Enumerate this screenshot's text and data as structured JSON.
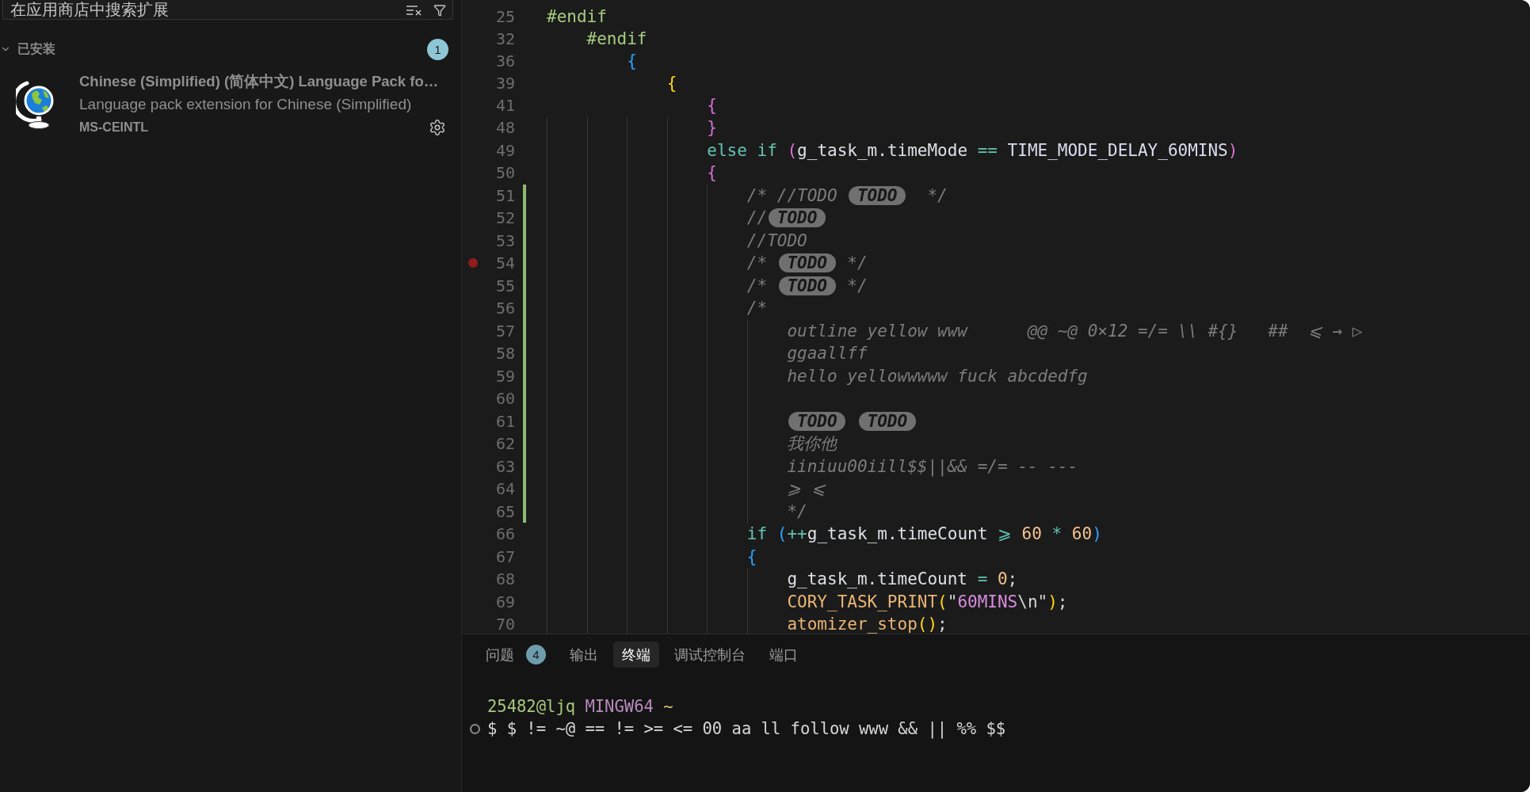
{
  "sidebar": {
    "search": {
      "placeholder": "在应用商店中搜索扩展"
    },
    "section": {
      "title": "已安装",
      "expanded": true,
      "count": "1"
    },
    "extensions": [
      {
        "name": "Chinese (Simplified) (简体中文) Language Pack fo…",
        "description": "Language pack extension for Chinese (Simplified)",
        "publisher": "MS-CEINTL"
      }
    ]
  },
  "editor": {
    "sticky_lines": [
      {
        "number": "25",
        "tokens": [
          {
            "kind": "preproc",
            "text": "#endif"
          }
        ]
      },
      {
        "number": "32",
        "tokens": [
          {
            "kind": "preproc",
            "text": "    #endif"
          }
        ]
      },
      {
        "number": "36",
        "tokens": [
          {
            "kind": "paren1",
            "text": "        {"
          }
        ]
      },
      {
        "number": "39",
        "tokens": [
          {
            "kind": "paren2",
            "text": "            {"
          }
        ]
      },
      {
        "number": "41",
        "tokens": [
          {
            "kind": "paren3",
            "text": "                {"
          }
        ]
      }
    ],
    "lines": [
      {
        "number": "48",
        "breakpoint": false,
        "modified": false,
        "tokens": [
          {
            "kind": "paren3",
            "text": "                }"
          }
        ]
      },
      {
        "number": "49",
        "breakpoint": false,
        "modified": false,
        "tokens": [
          {
            "kind": "keyword",
            "text": "                else if "
          },
          {
            "kind": "paren3",
            "text": "("
          },
          {
            "kind": "ident",
            "text": "g_task_m.timeMode "
          },
          {
            "kind": "operator",
            "text": "=="
          },
          {
            "kind": "macro",
            "text": " TIME_MODE_DELAY_60MINS"
          },
          {
            "kind": "paren3",
            "text": ")"
          }
        ]
      },
      {
        "number": "50",
        "breakpoint": false,
        "modified": false,
        "tokens": [
          {
            "kind": "paren3",
            "text": "                {"
          }
        ]
      },
      {
        "number": "51",
        "breakpoint": false,
        "modified": true,
        "tokens": [
          {
            "kind": "comment",
            "text": "                    /* //TODO "
          },
          {
            "kind": "todo",
            "text": "TODO"
          },
          {
            "kind": "comment",
            "text": "  */"
          }
        ]
      },
      {
        "number": "52",
        "breakpoint": false,
        "modified": true,
        "tokens": [
          {
            "kind": "comment",
            "text": "                    //"
          },
          {
            "kind": "todo",
            "text": "TODO"
          }
        ]
      },
      {
        "number": "53",
        "breakpoint": false,
        "modified": true,
        "tokens": [
          {
            "kind": "comment",
            "text": "                    //TODO"
          }
        ]
      },
      {
        "number": "54",
        "breakpoint": true,
        "modified": true,
        "tokens": [
          {
            "kind": "comment",
            "text": "                    /* "
          },
          {
            "kind": "todo",
            "text": "TODO"
          },
          {
            "kind": "comment",
            "text": " */"
          }
        ]
      },
      {
        "number": "55",
        "breakpoint": false,
        "modified": true,
        "tokens": [
          {
            "kind": "comment",
            "text": "                    /* "
          },
          {
            "kind": "todo",
            "text": "TODO"
          },
          {
            "kind": "comment",
            "text": " */"
          }
        ]
      },
      {
        "number": "56",
        "breakpoint": false,
        "modified": true,
        "tokens": [
          {
            "kind": "comment",
            "text": "                    /*"
          }
        ]
      },
      {
        "number": "57",
        "breakpoint": false,
        "modified": true,
        "tokens": [
          {
            "kind": "comment",
            "text": "                        outline yellow www      @@ ~@ 0×12 =/= \\\\ #{}   ##  ⩽ → ▷"
          }
        ]
      },
      {
        "number": "58",
        "breakpoint": false,
        "modified": true,
        "tokens": [
          {
            "kind": "comment",
            "text": "                        ggaallff"
          }
        ]
      },
      {
        "number": "59",
        "breakpoint": false,
        "modified": true,
        "tokens": [
          {
            "kind": "comment",
            "text": "                        hello yellowwwww fuck abcdedfg"
          }
        ]
      },
      {
        "number": "60",
        "breakpoint": false,
        "modified": true
      },
      {
        "number": "61",
        "breakpoint": false,
        "modified": true,
        "tokens": [
          {
            "kind": "todo",
            "text": "TODO"
          },
          {
            "kind": "todo",
            "text": "TODO"
          }
        ]
      },
      {
        "number": "62",
        "breakpoint": false,
        "modified": true,
        "tokens": [
          {
            "kind": "comment",
            "text": "                        我你他"
          }
        ]
      },
      {
        "number": "63",
        "breakpoint": false,
        "modified": true,
        "tokens": [
          {
            "kind": "comment",
            "text": "                        iiniuu00iill$$||&& =/= -- ---"
          }
        ]
      },
      {
        "number": "64",
        "breakpoint": false,
        "modified": true,
        "tokens": [
          {
            "kind": "comment",
            "text": "                        ⩾ ⩽"
          }
        ]
      },
      {
        "number": "65",
        "breakpoint": false,
        "modified": true,
        "tokens": [
          {
            "kind": "comment",
            "text": "                        */"
          }
        ]
      },
      {
        "number": "66",
        "breakpoint": false,
        "modified": false,
        "tokens": [
          {
            "kind": "keyword",
            "text": "                    if "
          },
          {
            "kind": "paren1",
            "text": "("
          },
          {
            "kind": "operator",
            "text": "++"
          },
          {
            "kind": "ident",
            "text": "g_task_m.timeCount "
          },
          {
            "kind": "operator",
            "text": "⩾"
          },
          {
            "kind": "number",
            "text": " 60"
          },
          {
            "kind": "operator",
            "text": " * "
          },
          {
            "kind": "number",
            "text": "60"
          },
          {
            "kind": "paren1",
            "text": ")"
          }
        ]
      },
      {
        "number": "67",
        "breakpoint": false,
        "modified": false,
        "tokens": [
          {
            "kind": "paren1",
            "text": "                    {"
          }
        ]
      },
      {
        "number": "68",
        "breakpoint": false,
        "modified": false,
        "tokens": [
          {
            "kind": "ident",
            "text": "                        g_task_m.timeCount "
          },
          {
            "kind": "operator",
            "text": "="
          },
          {
            "kind": "number",
            "text": " 0"
          },
          {
            "kind": "plain",
            "text": ";"
          }
        ]
      },
      {
        "number": "69",
        "breakpoint": false,
        "modified": false,
        "tokens": [
          {
            "kind": "function",
            "text": "                        CORY_TASK_PRINT"
          },
          {
            "kind": "paren2",
            "text": "("
          },
          {
            "kind": "plain",
            "text": "\""
          },
          {
            "kind": "string",
            "text": "60MINS"
          },
          {
            "kind": "plain",
            "text": "\\n\""
          },
          {
            "kind": "paren2",
            "text": ")"
          },
          {
            "kind": "plain",
            "text": ";"
          }
        ]
      },
      {
        "number": "70",
        "breakpoint": false,
        "modified": false,
        "tokens": [
          {
            "kind": "function",
            "text": "                        atomizer_stop"
          },
          {
            "kind": "paren2",
            "text": "()"
          },
          {
            "kind": "plain",
            "text": ";"
          }
        ]
      }
    ]
  },
  "panel": {
    "tabs": [
      {
        "label": "问题",
        "badge": "4",
        "selected": false
      },
      {
        "label": "输出",
        "selected": false
      },
      {
        "label": "终端",
        "selected": true
      },
      {
        "label": "调试控制台",
        "selected": false
      },
      {
        "label": "端口",
        "selected": false
      }
    ],
    "terminal": {
      "lines": [
        {
          "decorated": false,
          "segments": [
            {
              "kind": "user",
              "text": "25482@ljq"
            },
            {
              "kind": "system",
              "text": " MINGW64"
            },
            {
              "kind": "path",
              "text": " ~"
            }
          ]
        },
        {
          "decorated": true,
          "segments": [
            {
              "kind": "input",
              "text": "$ $ != ~@ == != >= <= 00 aa ll follow www && || %% $$"
            }
          ]
        }
      ]
    }
  }
}
